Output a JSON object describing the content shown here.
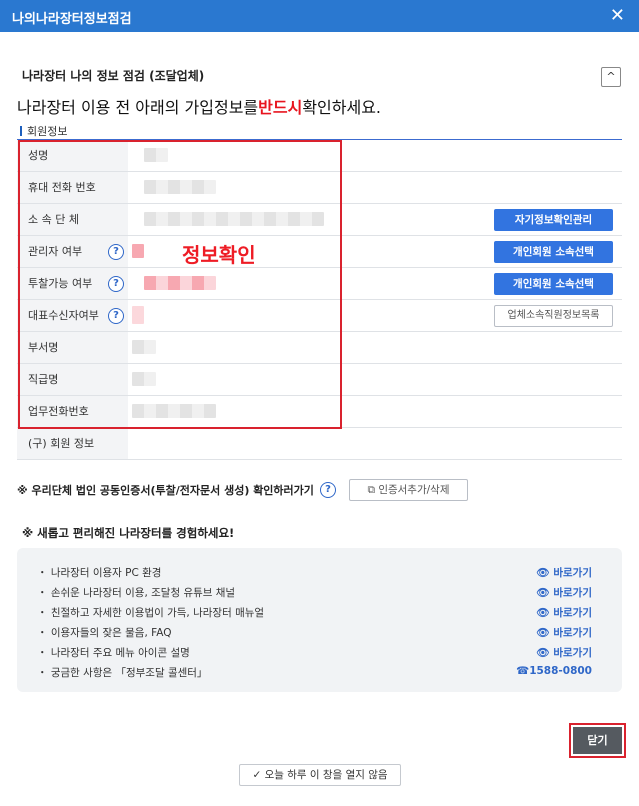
{
  "window": {
    "title": "나의나라장터정보점검",
    "close_icon": "close-icon"
  },
  "section": {
    "title": "나라장터 나의 정보 점검 (조달업체)",
    "collapse_glyph": "^"
  },
  "headline": {
    "before": "나라장터 이용 전 아래의 가입정보를",
    "emphasis": "반드시",
    "after": "확인하세요."
  },
  "member_info_label": "회원정보",
  "rows": [
    {
      "label": "성명"
    },
    {
      "label": "휴대 전화 번호"
    },
    {
      "label": "소 속 단 체",
      "button": "자기정보확인관리"
    },
    {
      "label": "관리자 여부",
      "help": "?",
      "button": "개인회원 소속선택"
    },
    {
      "label": "투찰가능 여부",
      "help": "?",
      "button": "개인회원 소속선택"
    },
    {
      "label": "대표수신자여부",
      "help": "?",
      "button": "업체소속직원정보목록"
    },
    {
      "label": "부서명"
    },
    {
      "label": "직급명"
    },
    {
      "label": "업무전화번호"
    },
    {
      "label": "(구) 회원 정보"
    }
  ],
  "annotation": {
    "text": "정보확인"
  },
  "certificate": {
    "text": "※ 우리단체 법인 공동인증서(투찰/전자문서 생성) 확인하러가기",
    "help": "?",
    "button": "인증서추가/삭제"
  },
  "promo": {
    "title": "※ 새롭고 편리해진 나라장터를 경험하세요!",
    "items": [
      {
        "text": "・ 나라장터 이용자 PC 환경",
        "link": "바로가기"
      },
      {
        "text": "・ 손쉬운 나라장터 이용, 조달청 유튜브 채널",
        "link": "바로가기"
      },
      {
        "text": "・ 친절하고 자세한 이용법이 가득, 나라장터 매뉴얼",
        "link": "바로가기"
      },
      {
        "text": "・ 이용자들의 잦은 물음, FAQ",
        "link": "바로가기"
      },
      {
        "text": "・ 나라장터 주요 메뉴 아이콘 설명",
        "link": "바로가기"
      },
      {
        "text": "・ 궁금한 사항은 「정부조달 콜센터」",
        "link": "1588-0800"
      }
    ]
  },
  "footer": {
    "close_button": "닫기",
    "today_button": "오늘 하루 이 창을 열지 않음"
  }
}
